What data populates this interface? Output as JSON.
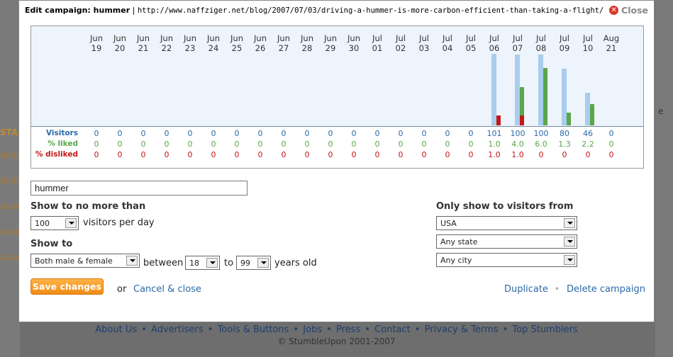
{
  "background": {
    "left_items": [
      "STA",
      "Activ",
      "Activ",
      "ause",
      "ause",
      "ause"
    ],
    "right_item": "e",
    "footer": {
      "links": [
        "About Us",
        "Advertisers",
        "Tools & Buttons",
        "Jobs",
        "Press",
        "Contact",
        "Privacy & Terms",
        "Top Stumblers"
      ],
      "copyright": "© StumbleUpon 2001-2007"
    }
  },
  "modal": {
    "title_prefix": "Edit campaign: ",
    "campaign_name": "hummer",
    "separator": " | ",
    "url": "http://www.naffziger.net/blog/2007/07/03/driving-a-hummer-is-more-carbon-efficient-than-taking-a-flight/",
    "close_label": "Close"
  },
  "chart_data": {
    "type": "bar",
    "categories": [
      [
        "Jun",
        "19"
      ],
      [
        "Jun",
        "20"
      ],
      [
        "Jun",
        "21"
      ],
      [
        "Jun",
        "22"
      ],
      [
        "Jun",
        "23"
      ],
      [
        "Jun",
        "24"
      ],
      [
        "Jun",
        "25"
      ],
      [
        "Jun",
        "26"
      ],
      [
        "Jun",
        "27"
      ],
      [
        "Jun",
        "28"
      ],
      [
        "Jun",
        "29"
      ],
      [
        "Jun",
        "30"
      ],
      [
        "Jul",
        "01"
      ],
      [
        "Jul",
        "02"
      ],
      [
        "Jul",
        "03"
      ],
      [
        "Jul",
        "04"
      ],
      [
        "Jul",
        "05"
      ],
      [
        "Jul",
        "06"
      ],
      [
        "Jul",
        "07"
      ],
      [
        "Jul",
        "08"
      ],
      [
        "Jul",
        "09"
      ],
      [
        "Jul",
        "10"
      ],
      [
        "Aug",
        "21"
      ]
    ],
    "series": [
      {
        "name": "Visitors",
        "values": [
          "0",
          "0",
          "0",
          "0",
          "0",
          "0",
          "0",
          "0",
          "0",
          "0",
          "0",
          "0",
          "0",
          "0",
          "0",
          "0",
          "0",
          "101",
          "100",
          "100",
          "80",
          "46",
          "0"
        ],
        "color": "#a9cdee"
      },
      {
        "name": "% liked",
        "values": [
          "0",
          "0",
          "0",
          "0",
          "0",
          "0",
          "0",
          "0",
          "0",
          "0",
          "0",
          "0",
          "0",
          "0",
          "0",
          "0",
          "0",
          "1.0",
          "4.0",
          "6.0",
          "1.3",
          "2.2",
          "0"
        ],
        "color": "#5aa64a"
      },
      {
        "name": "% disliked",
        "values": [
          "0",
          "0",
          "0",
          "0",
          "0",
          "0",
          "0",
          "0",
          "0",
          "0",
          "0",
          "0",
          "0",
          "0",
          "0",
          "0",
          "0",
          "1.0",
          "1.0",
          "0",
          "0",
          "0",
          "0"
        ],
        "color": "#c41818"
      }
    ]
  },
  "form": {
    "name_value": "hummer",
    "show_no_more_label": "Show to no more than",
    "visitors_limit": "100",
    "visitors_per_day": "visitors per day",
    "show_to_label": "Show to",
    "gender": "Both male & female",
    "between": "between",
    "age_min": "18",
    "to": "to",
    "age_max": "99",
    "years_old": "years old",
    "location_label": "Only show to visitors from",
    "country": "USA",
    "state": "Any state",
    "city": "Any city",
    "save_label": "Save changes",
    "or": "or",
    "cancel_label": "Cancel & close",
    "duplicate_label": "Duplicate",
    "delete_label": "Delete campaign"
  }
}
